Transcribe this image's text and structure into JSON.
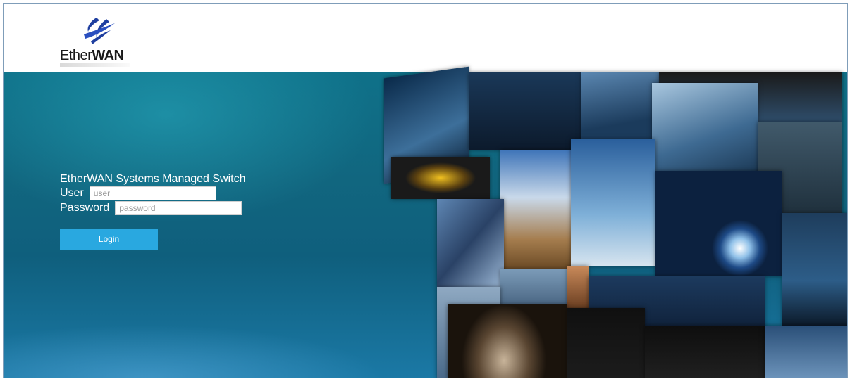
{
  "brand": {
    "logo_prefix": "Ether",
    "logo_suffix": "WAN",
    "logo_icon": "etherwan-swoosh-icon"
  },
  "login": {
    "title": "EtherWAN Systems Managed Switch",
    "user_label": "User",
    "user_placeholder": "user",
    "user_value": "",
    "password_label": "Password",
    "password_placeholder": "password",
    "password_value": "",
    "submit_label": "Login"
  },
  "colors": {
    "accent": "#29a8e0",
    "hero_top": "#0f7189",
    "hero_bottom": "#1b79a6",
    "logo_blue": "#1f3fa0"
  }
}
